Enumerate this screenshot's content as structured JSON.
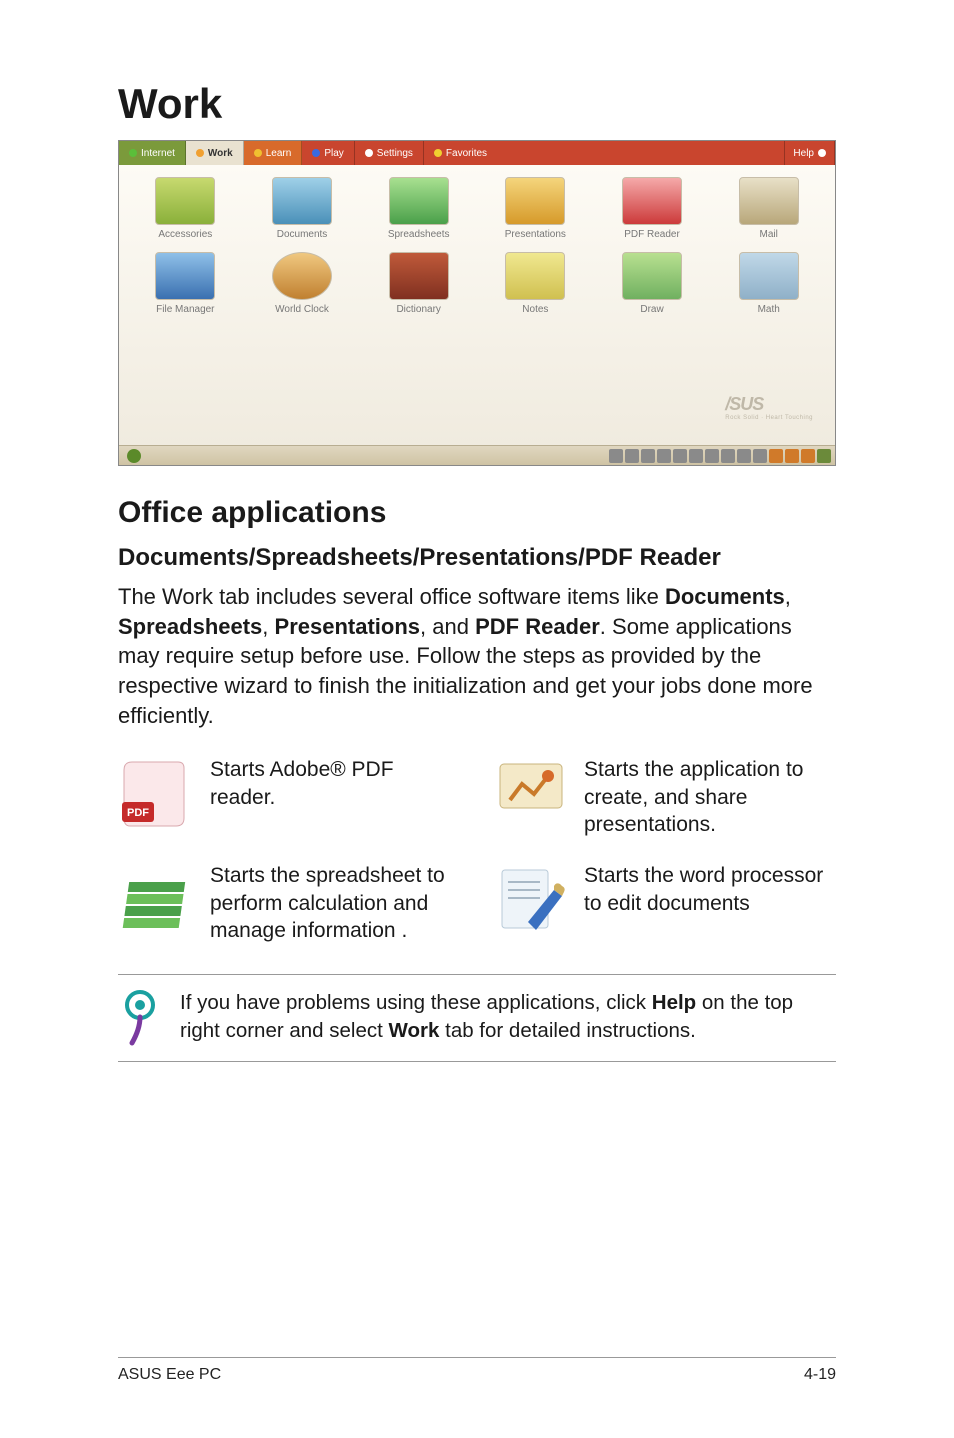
{
  "title": "Work",
  "screenshot": {
    "tabs": {
      "internet": "Internet",
      "work": "Work",
      "learn": "Learn",
      "play": "Play",
      "settings": "Settings",
      "favorites": "Favorites",
      "help": "Help"
    },
    "row1": [
      "Accessories",
      "Documents",
      "Spreadsheets",
      "Presentations",
      "PDF Reader",
      "Mail"
    ],
    "row2": [
      "File Manager",
      "World Clock",
      "Dictionary",
      "Notes",
      "Draw",
      "Math"
    ],
    "logo": "/SUS",
    "logo_sub": "Rock Solid · Heart Touching"
  },
  "section_heading": "Office applications",
  "sub_heading": "Documents/Spreadsheets/Presentations/PDF Reader",
  "intro": {
    "p1a": "The Work tab includes several office software items like ",
    "b1": "Documents",
    "sep1": ", ",
    "b2": "Spreadsheets",
    "sep2": ", ",
    "b3": "Presentations",
    "sep3": ", and ",
    "b4": "PDF Reader",
    "p1b": ". Some applications may require setup before use. Follow the steps as provided by the respective wizard to finish the initialization and get your jobs done more efficiently."
  },
  "apps": {
    "pdf": "Starts Adobe® PDF reader.",
    "presentations": "Starts the application to create, and share presentations.",
    "spreadsheet": "Starts the spreadsheet to perform calculation and manage information .",
    "documents": "Starts the word processor to edit documents"
  },
  "note": {
    "t1": "If you have problems using these applications, click ",
    "b1": "Help",
    "t2": " on the top right corner and select ",
    "b2": "Work",
    "t3": " tab for detailed instructions."
  },
  "footer": {
    "left": "ASUS Eee PC",
    "right": "4-19"
  }
}
